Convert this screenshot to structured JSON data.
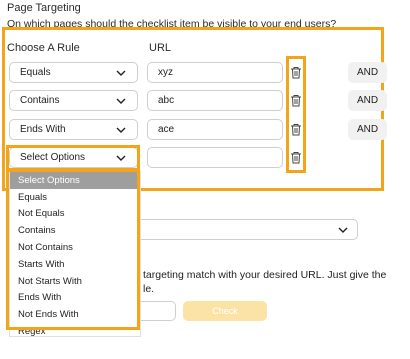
{
  "section": {
    "title": "Page Targeting",
    "subtitle": "On which pages should the checklist item be visible to your end users?"
  },
  "columns": {
    "rule": "Choose A Rule",
    "url": "URL"
  },
  "rules": [
    {
      "rule": "Equals",
      "url": "xyz",
      "and_label": "AND"
    },
    {
      "rule": "Contains",
      "url": "abc",
      "and_label": "AND"
    },
    {
      "rule": "Ends With",
      "url": "ace",
      "and_label": "AND"
    },
    {
      "rule": "Select Options",
      "url": ""
    }
  ],
  "dropdown": {
    "options": [
      "Select Options",
      "Equals",
      "Not Equals",
      "Contains",
      "Not Contains",
      "Starts With",
      "Not Starts With",
      "Ends With",
      "Not Ends With",
      "Regex"
    ],
    "selected": "Select Options"
  },
  "test": {
    "description": "targeting match with your desired URL. Just give the",
    "description2": "le.",
    "check_label": "Check"
  },
  "colors": {
    "highlight": "#f2a51a",
    "check_button": "#fbe3a5",
    "and_button": "#f1f1f1"
  }
}
